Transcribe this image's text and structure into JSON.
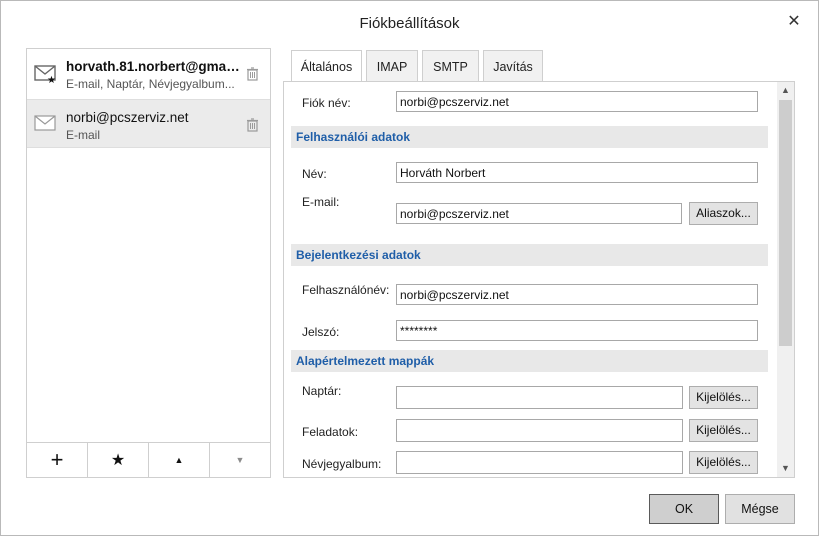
{
  "dialog": {
    "title": "Fiókbeállítások",
    "close_glyph": "✕"
  },
  "accounts": [
    {
      "name": "horvath.81.norbert@gmail...",
      "subtitle": "E-mail, Naptár, Névjegyalbum...",
      "icon": "mail-icon",
      "default": true,
      "selected": false
    },
    {
      "name": "norbi@pcszerviz.net",
      "subtitle": "E-mail",
      "icon": "mail-icon",
      "default": false,
      "selected": true
    }
  ],
  "account_toolbar": {
    "add": "+",
    "default": "★",
    "up": "▲",
    "down": "▼"
  },
  "tabs": [
    {
      "label": "Általános",
      "active": true
    },
    {
      "label": "IMAP",
      "active": false
    },
    {
      "label": "SMTP",
      "active": false
    },
    {
      "label": "Javítás",
      "active": false
    }
  ],
  "general": {
    "account_name_label": "Fiók név:",
    "account_name_value": "norbi@pcszerviz.net",
    "user_section": "Felhasználói adatok",
    "name_label": "Név:",
    "name_value": "Horváth Norbert",
    "email_label": "E-mail:",
    "email_value": "norbi@pcszerviz.net",
    "aliases_button": "Aliaszok...",
    "login_section": "Bejelentkezési adatok",
    "username_label": "Felhasználónév:",
    "username_value": "norbi@pcszerviz.net",
    "password_label": "Jelszó:",
    "password_value": "********",
    "folders_section": "Alapértelmezett mappák",
    "calendar_label": "Naptár:",
    "calendar_value": "",
    "tasks_label": "Feladatok:",
    "tasks_value": "",
    "contacts_label": "Névjegyalbum:",
    "contacts_value": "",
    "select_button": "Kijelölés..."
  },
  "footer": {
    "ok": "OK",
    "cancel": "Mégse"
  },
  "colors": {
    "section_text": "#1f5ea8",
    "section_bg": "#e8e8e8",
    "selected_row": "#ebebeb"
  }
}
